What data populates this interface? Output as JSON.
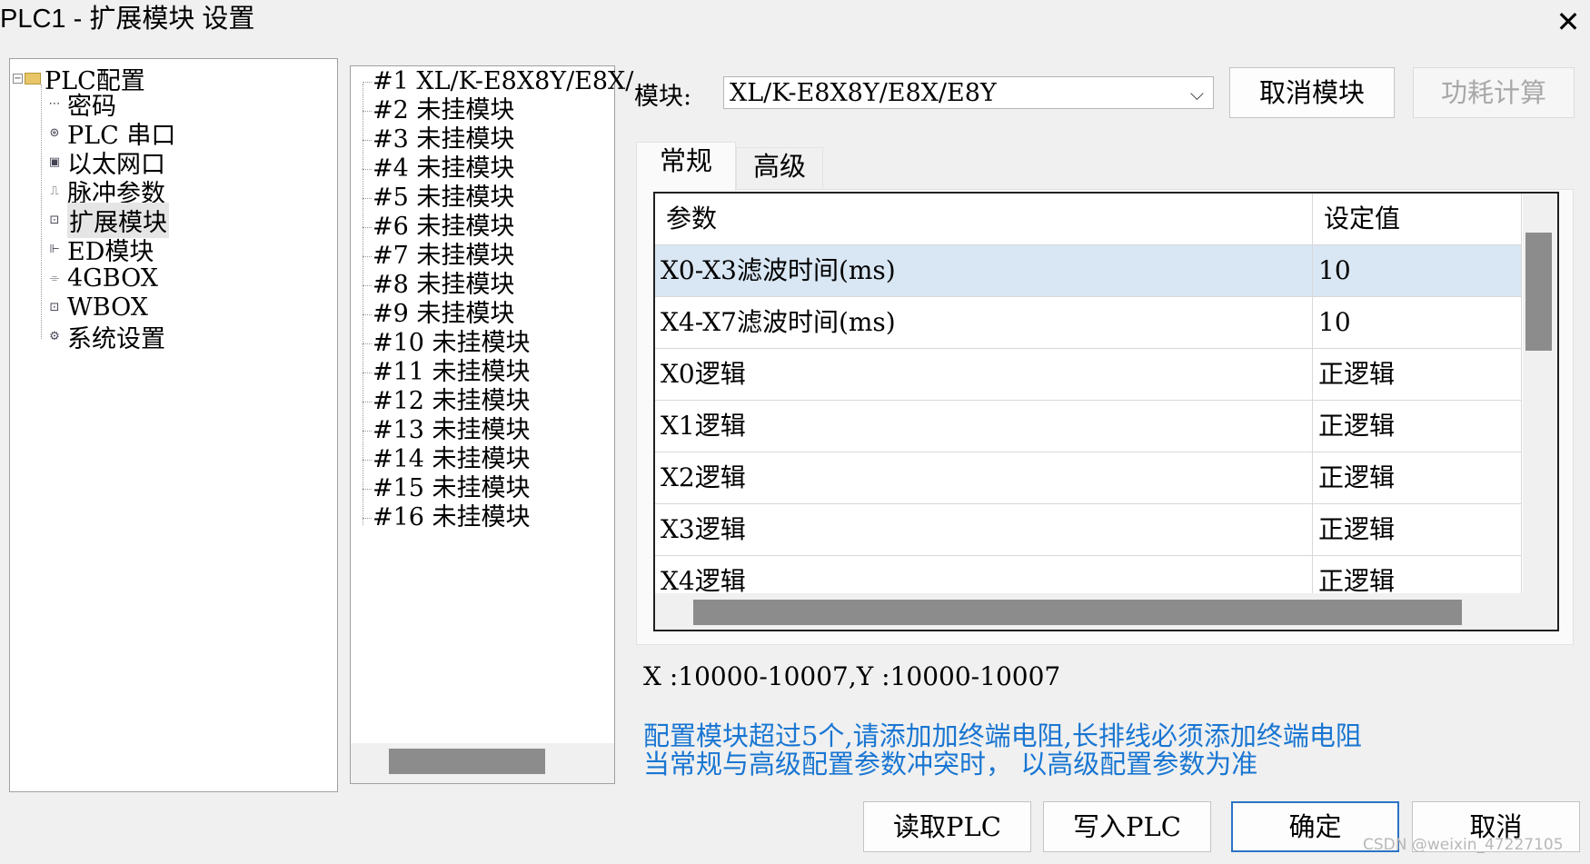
{
  "window": {
    "title": "PLC1 - 扩展模块  设置",
    "close_glyph": "✕"
  },
  "tree": {
    "root": {
      "label": "PLC配置",
      "expander": "−"
    },
    "items": [
      {
        "label": "密码",
        "icon": "password-icon",
        "glyph": "⋯"
      },
      {
        "label": "PLC 串口",
        "icon": "serial-port-icon",
        "glyph": "⊛"
      },
      {
        "label": "以太网口",
        "icon": "ethernet-icon",
        "glyph": "▣"
      },
      {
        "label": "脉冲参数",
        "icon": "pulse-icon",
        "glyph": "⎍"
      },
      {
        "label": "扩展模块",
        "icon": "expansion-module-icon",
        "glyph": "⊡",
        "selected": true
      },
      {
        "label": "ED模块",
        "icon": "ed-module-icon",
        "glyph": "⊩"
      },
      {
        "label": "4GBOX",
        "icon": "4gbox-icon",
        "glyph": "⌯"
      },
      {
        "label": "WBOX",
        "icon": "wbox-icon",
        "glyph": "⊡"
      },
      {
        "label": "系统设置",
        "icon": "system-settings-icon",
        "glyph": "⚙"
      }
    ]
  },
  "slots": [
    "#1 XL/K-E8X8Y/E8X/",
    "#2 未挂模块",
    "#3 未挂模块",
    "#4 未挂模块",
    "#5 未挂模块",
    "#6 未挂模块",
    "#7 未挂模块",
    "#8 未挂模块",
    "#9 未挂模块",
    "#10 未挂模块",
    "#11 未挂模块",
    "#12 未挂模块",
    "#13 未挂模块",
    "#14 未挂模块",
    "#15 未挂模块",
    "#16 未挂模块"
  ],
  "module": {
    "label": "模块:",
    "selected_value": "XL/K-E8X8Y/E8X/E8Y",
    "dropdown_glyph": "⌵"
  },
  "buttons": {
    "cancel_module": "取消模块",
    "power_calc": "功耗计算",
    "read_plc": "读取PLC",
    "write_plc": "写入PLC",
    "ok": "确定",
    "cancel": "取消"
  },
  "tabs": [
    "常规",
    "高级"
  ],
  "grid": {
    "headers": [
      "参数",
      "设定值"
    ],
    "rows": [
      {
        "param": "X0-X3滤波时间(ms)",
        "value": "10",
        "selected": true
      },
      {
        "param": "X4-X7滤波时间(ms)",
        "value": "10"
      },
      {
        "param": "X0逻辑",
        "value": "正逻辑"
      },
      {
        "param": "X1逻辑",
        "value": "正逻辑"
      },
      {
        "param": "X2逻辑",
        "value": "正逻辑"
      },
      {
        "param": "X3逻辑",
        "value": "正逻辑"
      },
      {
        "param": "X4逻辑",
        "value": "正逻辑"
      }
    ]
  },
  "io_range": "X :10000-10007,Y :10000-10007",
  "notes": [
    "配置模块超过5个,请添加加终端电阻,长排线必须添加终端电阻",
    "当常规与高级配置参数冲突时， 以高级配置参数为准"
  ],
  "watermark": "CSDN @weixin_47227105"
}
